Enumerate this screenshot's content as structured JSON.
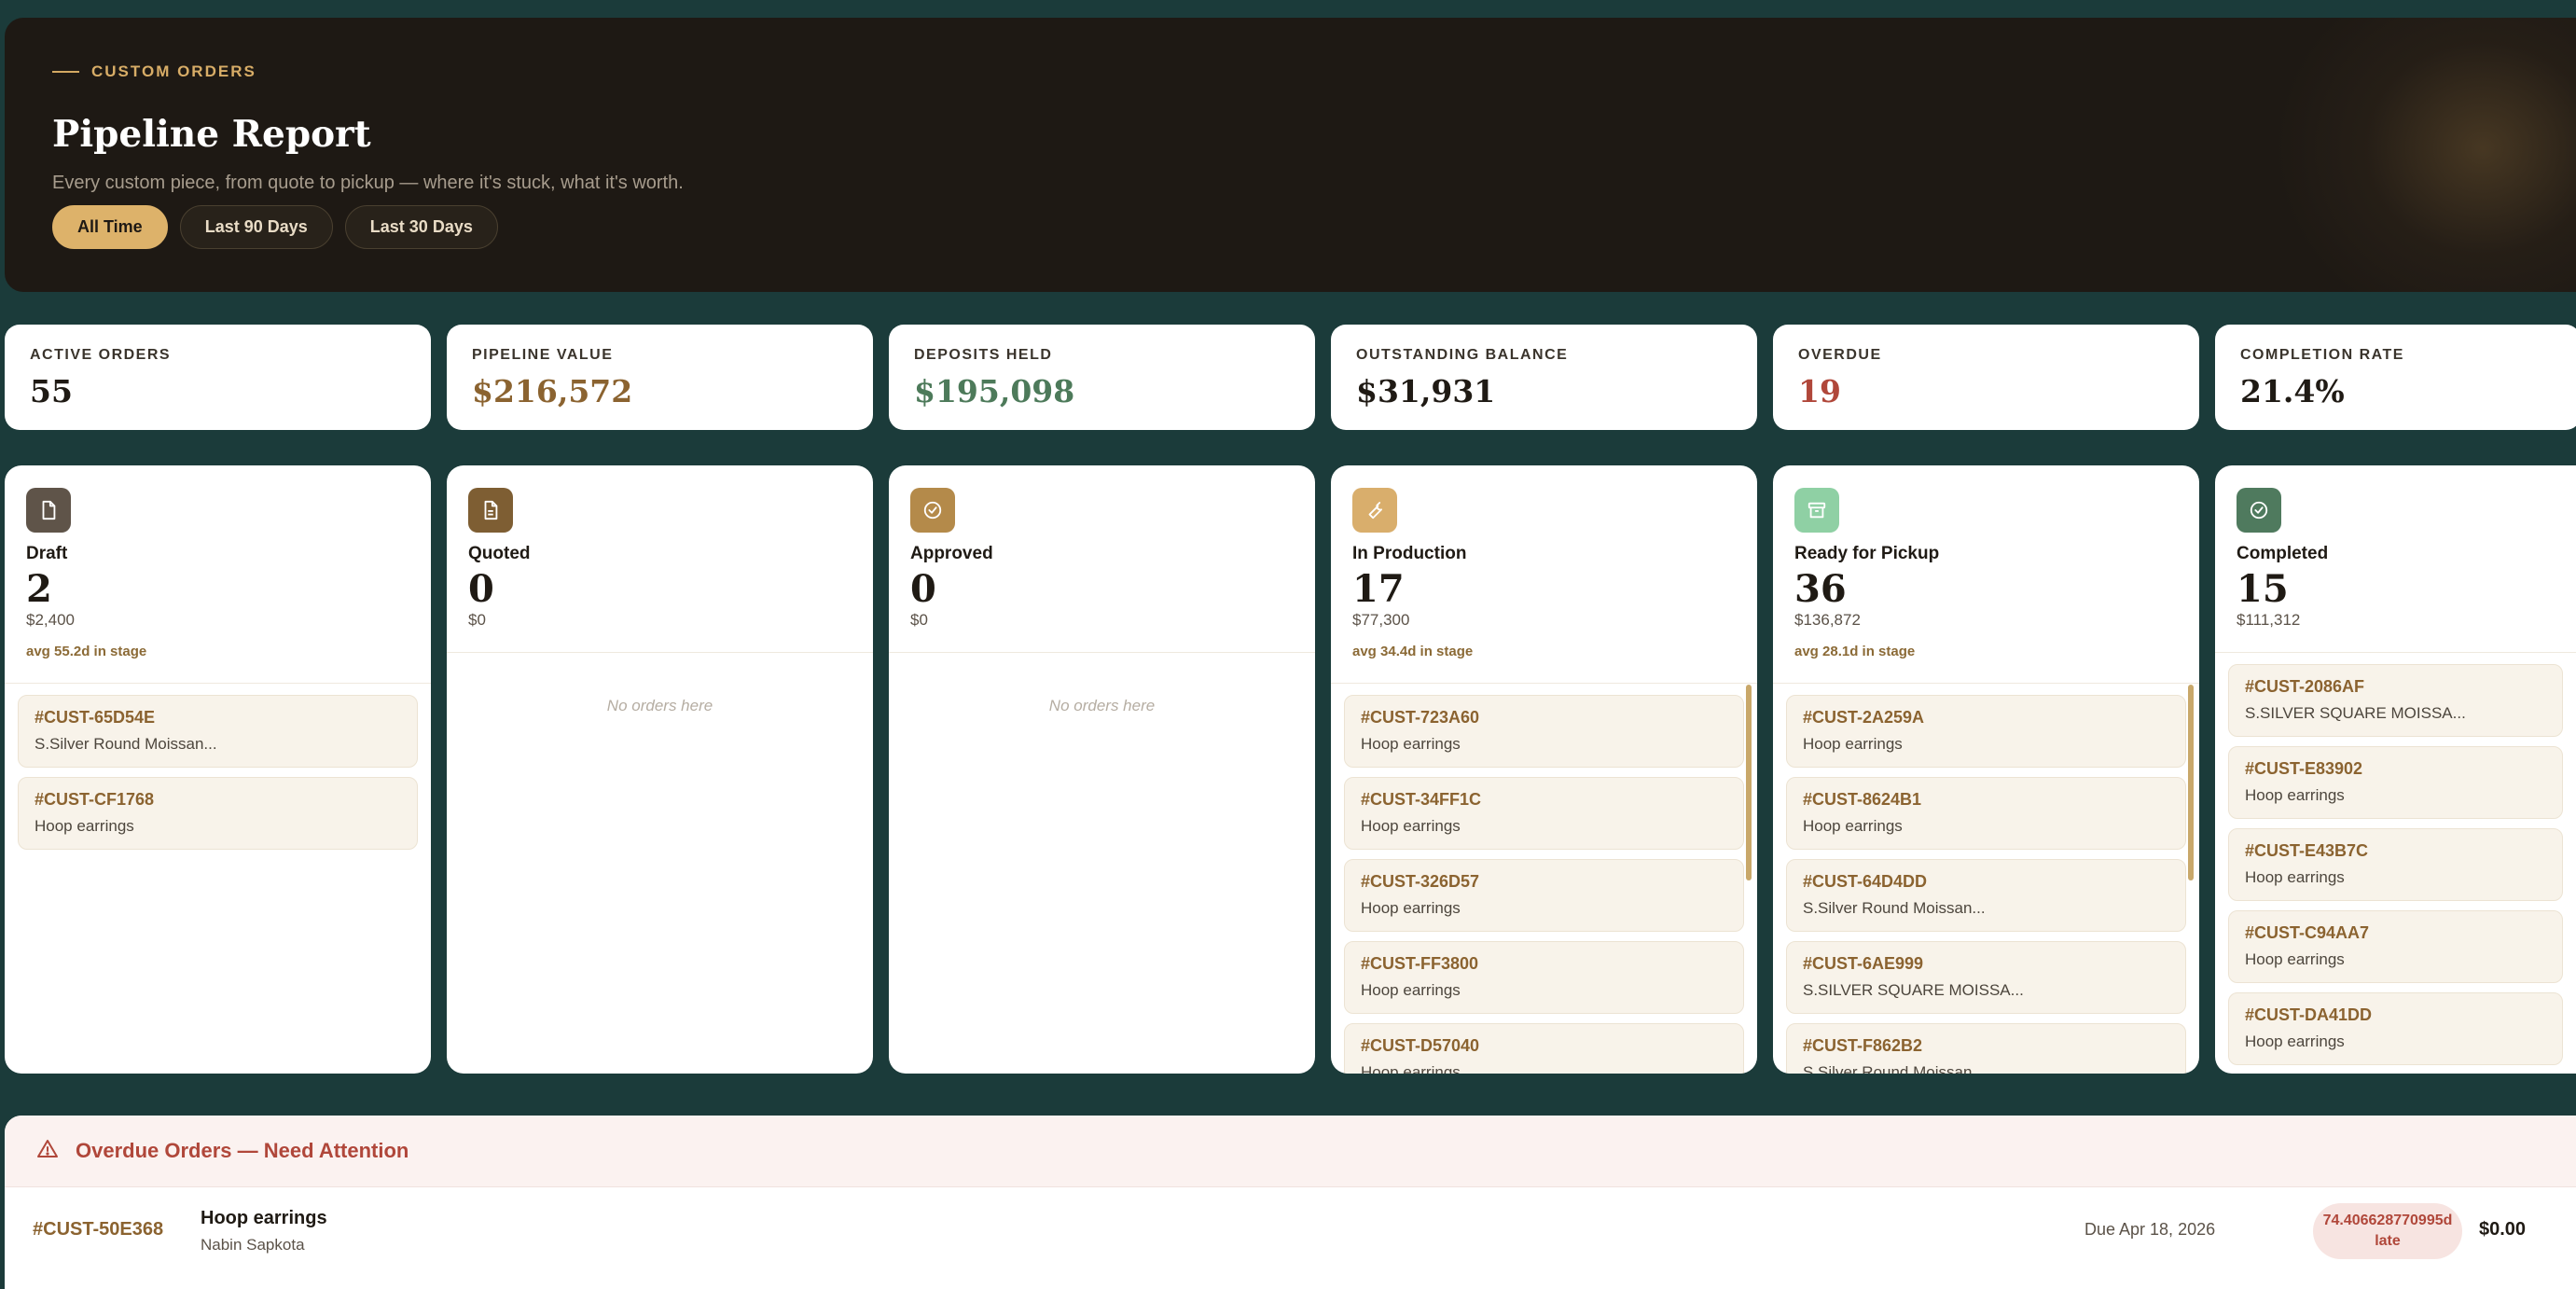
{
  "hero": {
    "eyebrow": "CUSTOM ORDERS",
    "title": "Pipeline Report",
    "subtitle": "Every custom piece, from quote to pickup — where it's stuck, what it's worth.",
    "filters": [
      {
        "label": "All Time",
        "active": true
      },
      {
        "label": "Last 90 Days",
        "active": false
      },
      {
        "label": "Last 30 Days",
        "active": false
      }
    ]
  },
  "stats": [
    {
      "label": "ACTIVE ORDERS",
      "value": "55",
      "color": "#1f1a14"
    },
    {
      "label": "PIPELINE VALUE",
      "value": "$216,572",
      "color": "#8b6330"
    },
    {
      "label": "DEPOSITS HELD",
      "value": "$195,098",
      "color": "#4d7a5a"
    },
    {
      "label": "OUTSTANDING BALANCE",
      "value": "$31,931",
      "color": "#1f1a14"
    },
    {
      "label": "OVERDUE",
      "value": "19",
      "color": "#b0473a"
    },
    {
      "label": "COMPLETION RATE",
      "value": "21.4%",
      "color": "#1f1a14"
    }
  ],
  "stages": [
    {
      "name": "Draft",
      "count": "2",
      "value": "$2,400",
      "avg": "avg 55.2d in stage",
      "icon": "document-icon",
      "icon_bg": "#5f5449",
      "orders": [
        {
          "id": "#CUST-65D54E",
          "item": "S.Silver Round Moissan..."
        },
        {
          "id": "#CUST-CF1768",
          "item": "Hoop earrings"
        }
      ],
      "empty": ""
    },
    {
      "name": "Quoted",
      "count": "0",
      "value": "$0",
      "avg": "",
      "icon": "quote-document-icon",
      "icon_bg": "#7e5e33",
      "orders": [],
      "empty": "No orders here"
    },
    {
      "name": "Approved",
      "count": "0",
      "value": "$0",
      "avg": "",
      "icon": "check-circle-icon",
      "icon_bg": "#b48a4a",
      "orders": [],
      "empty": "No orders here"
    },
    {
      "name": "In Production",
      "count": "17",
      "value": "$77,300",
      "avg": "avg 34.4d in stage",
      "icon": "wrench-icon",
      "icon_bg": "#d9ae6c",
      "orders": [
        {
          "id": "#CUST-723A60",
          "item": "Hoop earrings"
        },
        {
          "id": "#CUST-34FF1C",
          "item": "Hoop earrings"
        },
        {
          "id": "#CUST-326D57",
          "item": "Hoop earrings"
        },
        {
          "id": "#CUST-FF3800",
          "item": "Hoop earrings"
        },
        {
          "id": "#CUST-D57040",
          "item": "Hoop earrings"
        }
      ],
      "empty": ""
    },
    {
      "name": "Ready for Pickup",
      "count": "36",
      "value": "$136,872",
      "avg": "avg 28.1d in stage",
      "icon": "archive-box-icon",
      "icon_bg": "#8fd0a4",
      "orders": [
        {
          "id": "#CUST-2A259A",
          "item": "Hoop earrings"
        },
        {
          "id": "#CUST-8624B1",
          "item": "Hoop earrings"
        },
        {
          "id": "#CUST-64D4DD",
          "item": "S.Silver Round Moissan..."
        },
        {
          "id": "#CUST-6AE999",
          "item": "S.SILVER SQUARE MOISSA..."
        },
        {
          "id": "#CUST-F862B2",
          "item": "S.Silver Round Moissan..."
        }
      ],
      "empty": ""
    },
    {
      "name": "Completed",
      "count": "15",
      "value": "$111,312",
      "avg": "",
      "icon": "check-circle-icon",
      "icon_bg": "#4f7a5e",
      "orders": [
        {
          "id": "#CUST-2086AF",
          "item": "S.SILVER SQUARE MOISSA..."
        },
        {
          "id": "#CUST-E83902",
          "item": "Hoop earrings"
        },
        {
          "id": "#CUST-E43B7C",
          "item": "Hoop earrings"
        },
        {
          "id": "#CUST-C94AA7",
          "item": "Hoop earrings"
        },
        {
          "id": "#CUST-DA41DD",
          "item": "Hoop earrings"
        }
      ],
      "empty": ""
    }
  ],
  "overdue": {
    "title": "Overdue Orders — Need Attention",
    "icon": "warning-triangle-icon",
    "rows": [
      {
        "id": "#CUST-50E368",
        "item": "Hoop earrings",
        "customer": "Nabin Sapkota",
        "due": "Due Apr 18, 2026",
        "late": "74.406628770995d late",
        "amount": "$0.00"
      }
    ]
  },
  "colors": {
    "background": "#1b3b3a",
    "hero_bg": "#1e1914",
    "accent_gold": "#ddb26a",
    "danger": "#b0473a"
  }
}
